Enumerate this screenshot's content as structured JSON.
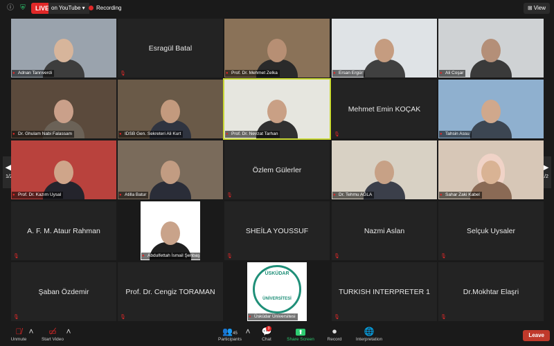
{
  "topbar": {
    "live_label": "LIVE",
    "stream_label": "on YouTube",
    "recording_label": "Recording",
    "view_label": "View"
  },
  "nav": {
    "page_left": "1/2",
    "page_right": "1/2"
  },
  "tiles": [
    {
      "name": "Adnan Tanrıverdi",
      "type": "video",
      "bg": "#9aa3ad",
      "skin": "#d7b59b",
      "shirt": "#3d3d3d"
    },
    {
      "name": "Esragül Batal",
      "type": "name"
    },
    {
      "name": "Prof. Dr. Mehmet Zelka",
      "type": "video",
      "bg": "#8a7258",
      "skin": "#b78f74",
      "shirt": "#2a2a2a"
    },
    {
      "name": "Ersan Ergür",
      "type": "video",
      "bg": "#dfe3e6",
      "skin": "#c59c80",
      "shirt": "#404040"
    },
    {
      "name": "Ali Coşar",
      "type": "video",
      "bg": "#cfd2d4",
      "skin": "#b48f78",
      "shirt": "#3a3a3a"
    },
    {
      "name": "Dr. Ghulam Nabi Falassam",
      "type": "video",
      "bg": "#5b4a3c",
      "skin": "#caa08a",
      "shirt": "#6b6257"
    },
    {
      "name": "IDSB Gen. Sekreteri Ali Kurt",
      "type": "video",
      "bg": "#6a5a48",
      "skin": "#c39a7e",
      "shirt": "#2f3440"
    },
    {
      "name": "Prof. Dr. Nevzat Tarhan",
      "type": "video",
      "bg": "#e6e6df",
      "skin": "#c9a085",
      "shirt": "#303030",
      "active": true
    },
    {
      "name": "Mehmet Emin KOÇAK",
      "type": "name"
    },
    {
      "name": "Tahsin Assu",
      "type": "video",
      "bg": "#8fb0cf",
      "skin": "#d0a88c",
      "shirt": "#3c4652"
    },
    {
      "name": "Prof. Dr. Kazım Uysal",
      "type": "video",
      "bg": "#b9423d",
      "skin": "#cfa58a",
      "shirt": "#24242c"
    },
    {
      "name": "Atilla Batur",
      "type": "video",
      "bg": "#7a6b5b",
      "skin": "#c29c82",
      "shirt": "#2a2d38"
    },
    {
      "name": "Özlem Gülerler",
      "type": "name"
    },
    {
      "name": "Dr. Tehmu AĞLA",
      "type": "video",
      "bg": "#d8d1c4",
      "skin": "#c7a186",
      "shirt": "#3b3f4a"
    },
    {
      "name": "Sahar Zaki Kabel",
      "type": "video",
      "bg": "#d7c7b7",
      "skin": "#d9b394",
      "shirt": "#8a6a55",
      "hijab": "#f0d3c7"
    },
    {
      "name": "A. F. M. Ataur Rahman",
      "type": "name"
    },
    {
      "name": "Abdulfettah İsmail Şenbaş",
      "type": "photo",
      "bg": "#ffffff",
      "skin": "#c9a38a",
      "shirt": "#202020"
    },
    {
      "name": "SHEİLA YOUSSUF",
      "type": "name"
    },
    {
      "name": "Nazmi Aslan",
      "type": "name"
    },
    {
      "name": "Selçuk Uysaler",
      "type": "name"
    },
    {
      "name": "Şaban Özdemir",
      "type": "name"
    },
    {
      "name": "Prof. Dr. Cengiz TORAMAN",
      "type": "name"
    },
    {
      "name": "Üsküdar Üniversitesi",
      "type": "logo",
      "logo_top": "ÜSKÜDAR",
      "logo_side": "ÜNİVERSİTESİ"
    },
    {
      "name": "TURKISH INTERPRETER 1",
      "type": "name"
    },
    {
      "name": "Dr.Mokhtar Elaşri",
      "type": "name"
    }
  ],
  "toolbar": {
    "unmute_label": "Unmute",
    "start_video_label": "Start Video",
    "participants_label": "Participants",
    "participants_count": "45",
    "chat_label": "Chat",
    "chat_badge": "3",
    "share_label": "Share Screen",
    "record_label": "Record",
    "interpretation_label": "Interpretation",
    "leave_label": "Leave"
  },
  "colors": {
    "accent": "#c9d934",
    "live": "#e02828",
    "share": "#2ecc71",
    "leave": "#c0392b"
  }
}
